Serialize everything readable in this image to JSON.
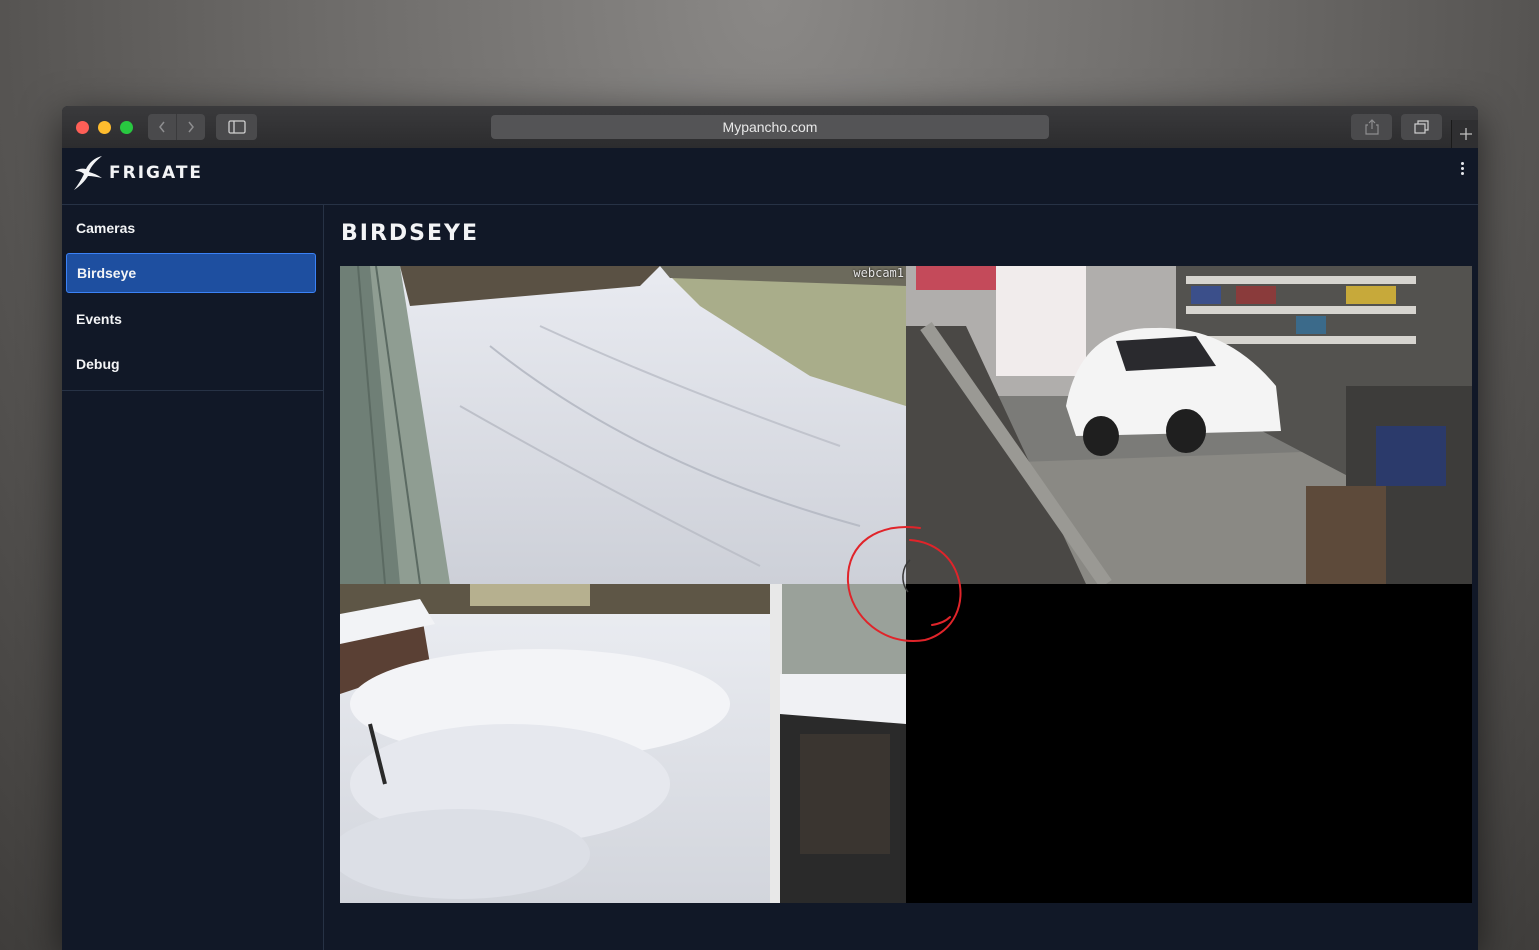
{
  "browser": {
    "url": "Mypancho.com"
  },
  "app": {
    "brand": "FRIGATE"
  },
  "sidebar": {
    "items": [
      {
        "label": "Cameras",
        "active": false
      },
      {
        "label": "Birdseye",
        "active": true
      },
      {
        "label": "Events",
        "active": false
      },
      {
        "label": "Debug",
        "active": false
      }
    ]
  },
  "main": {
    "title": "BIRDSEYE",
    "cameras": [
      {
        "name": "webcam1",
        "scene": "snowy-yard-driveway"
      },
      {
        "name": "",
        "scene": "garage-white-car"
      },
      {
        "name": "",
        "scene": "snowy-patio-porch"
      },
      {
        "name": "",
        "scene": "empty-black"
      }
    ]
  },
  "colors": {
    "accent": "#1e4fa0",
    "background": "#111827",
    "annotation": "#e0242a"
  }
}
